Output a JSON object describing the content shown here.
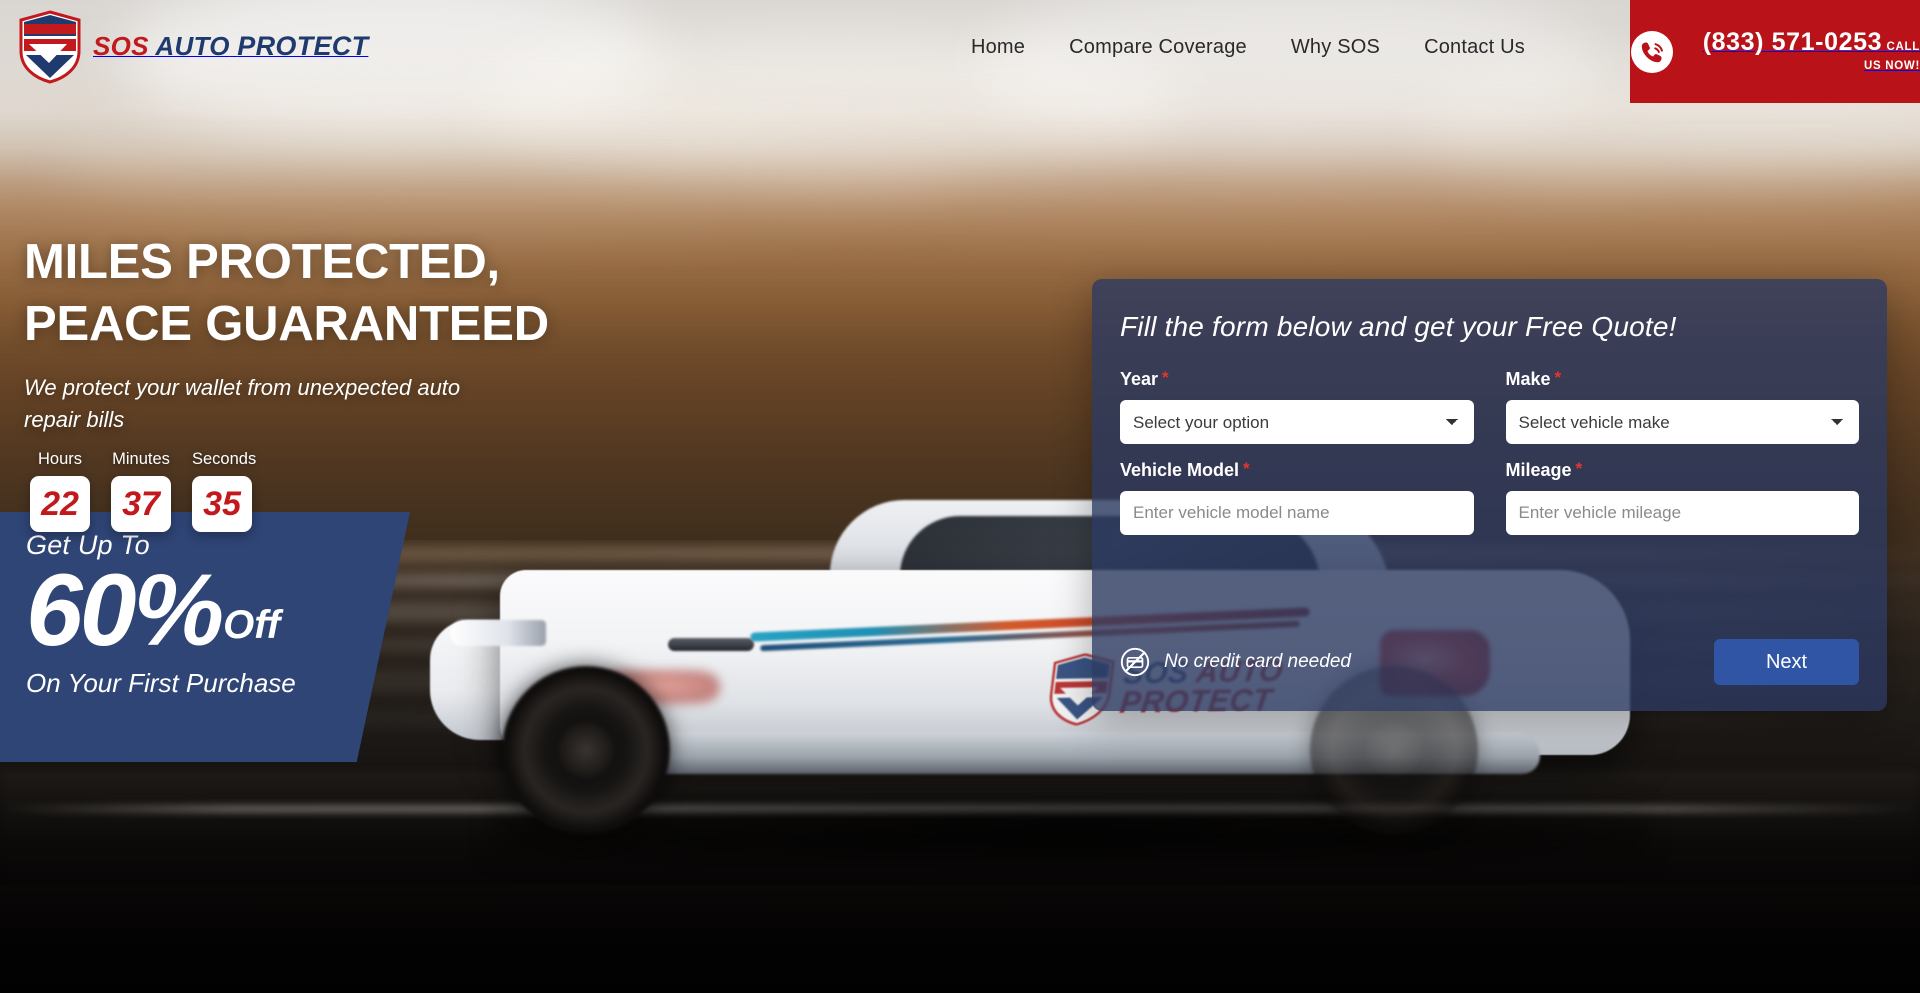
{
  "brand": {
    "logo_line1_red": "SOS",
    "logo_line1_navy": "AUTO",
    "logo_line2": "PROTECT",
    "colors": {
      "red": "#c2191c",
      "navy": "#1e3a6e",
      "panel_navy": "#2c3960",
      "promo_blue": "#2f4576",
      "button_blue": "#2f55a4",
      "phone_red": "#b91319"
    }
  },
  "header": {
    "nav": [
      {
        "label": "Home",
        "name": "nav-home"
      },
      {
        "label": "Compare Coverage",
        "name": "nav-compare-coverage"
      },
      {
        "label": "Why SOS",
        "name": "nav-why-sos"
      },
      {
        "label": "Contact Us",
        "name": "nav-contact-us"
      }
    ],
    "phone": {
      "number": "(833) 571-0253",
      "subtitle": "CALL US NOW!",
      "icon": "phone-icon"
    }
  },
  "hero": {
    "heading_line1": "MILES PROTECTED,",
    "heading_line2": "PEACE GUARANTEED",
    "subheading": "We protect your wallet from unexpected auto repair bills"
  },
  "countdown": {
    "units": [
      {
        "label": "Hours",
        "value": "22",
        "name": "countdown-hours"
      },
      {
        "label": "Minutes",
        "value": "37",
        "name": "countdown-minutes"
      },
      {
        "label": "Seconds",
        "value": "35",
        "name": "countdown-seconds"
      }
    ]
  },
  "promo": {
    "top_text": "Get Up To",
    "percent": "60%",
    "off": "Off",
    "bottom_text": "On Your First Purchase"
  },
  "quote_form": {
    "title": "Fill the form below and get your Free Quote!",
    "required_marker": "*",
    "fields": [
      {
        "label": "Year",
        "type": "select",
        "value": "Select your option",
        "required": true,
        "name": "year-select"
      },
      {
        "label": "Make",
        "type": "select",
        "value": "Select vehicle make",
        "required": true,
        "name": "make-select"
      },
      {
        "label": "Vehicle Model",
        "type": "text",
        "placeholder": "Enter vehicle model name",
        "value": "",
        "required": true,
        "name": "vehicle-model-input"
      },
      {
        "label": "Mileage",
        "type": "text",
        "placeholder": "Enter vehicle mileage",
        "value": "",
        "required": true,
        "name": "mileage-input"
      }
    ],
    "no_credit_card_text": "No credit card needed",
    "no_credit_card_icon": "no-credit-card-icon",
    "next_button": "Next"
  },
  "car_decal": {
    "line1_navy": "SOS",
    "line1_red": "AUTO",
    "line2": "PROTECT"
  }
}
